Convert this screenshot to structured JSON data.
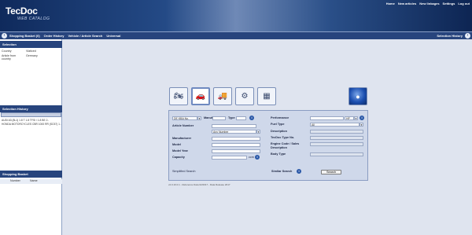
{
  "header": {
    "logo": "TecDoc",
    "logo_sub": "WEB CATALOG",
    "links": [
      "Home",
      "New articles",
      "New linkages",
      "Settings",
      "Log out"
    ]
  },
  "navbar": {
    "items": [
      "Shopping Basket (0)",
      "Order History",
      "Vehicle / Article Search",
      "Universal"
    ],
    "right": "Selection History"
  },
  "sidebar": {
    "selection_title": "Selection",
    "rows": [
      {
        "label": "Country",
        "value": "Viaticed"
      },
      {
        "label": "Article from country",
        "value": "Germany"
      }
    ],
    "history_title": "Selection History",
    "history": [
      "AUDI A3 (8L1) 1.8 T  1.8 TFSI / 1.8 BE 2..",
      "HONDA MOTORCYCLES CBR 1000 RR (SC57) 1..."
    ],
    "basket_title": "Shopping Basket",
    "basket_cols": [
      "Number",
      "Name"
    ]
  },
  "form": {
    "kba_select": "DE KBA No.",
    "manuf_label": "Manuf.",
    "type_label": "Type",
    "article_label": "Article Number",
    "article_select": "Any Number",
    "manufacturer_label": "Manufacturer",
    "model_label": "Model",
    "model_year_label": "Model Year",
    "capacity_label": "Capacity",
    "capacity_unit": "ccm",
    "performance_label": "Performance",
    "performance_unit": "HP",
    "fuel_label": "Fuel Type",
    "fuel_value": "All",
    "description_label": "Description",
    "tecdoc_type_label": "TecDoc Type No.",
    "engine_label": "Engine Code / Sales Description",
    "body_label": "Body Type",
    "simplified": "Simplified Search",
    "similar": "Similar Search",
    "search_button": "Search"
  },
  "footer": "v2.0.10.0.1 - Reference Data 02/2017 - Data Release 2017"
}
